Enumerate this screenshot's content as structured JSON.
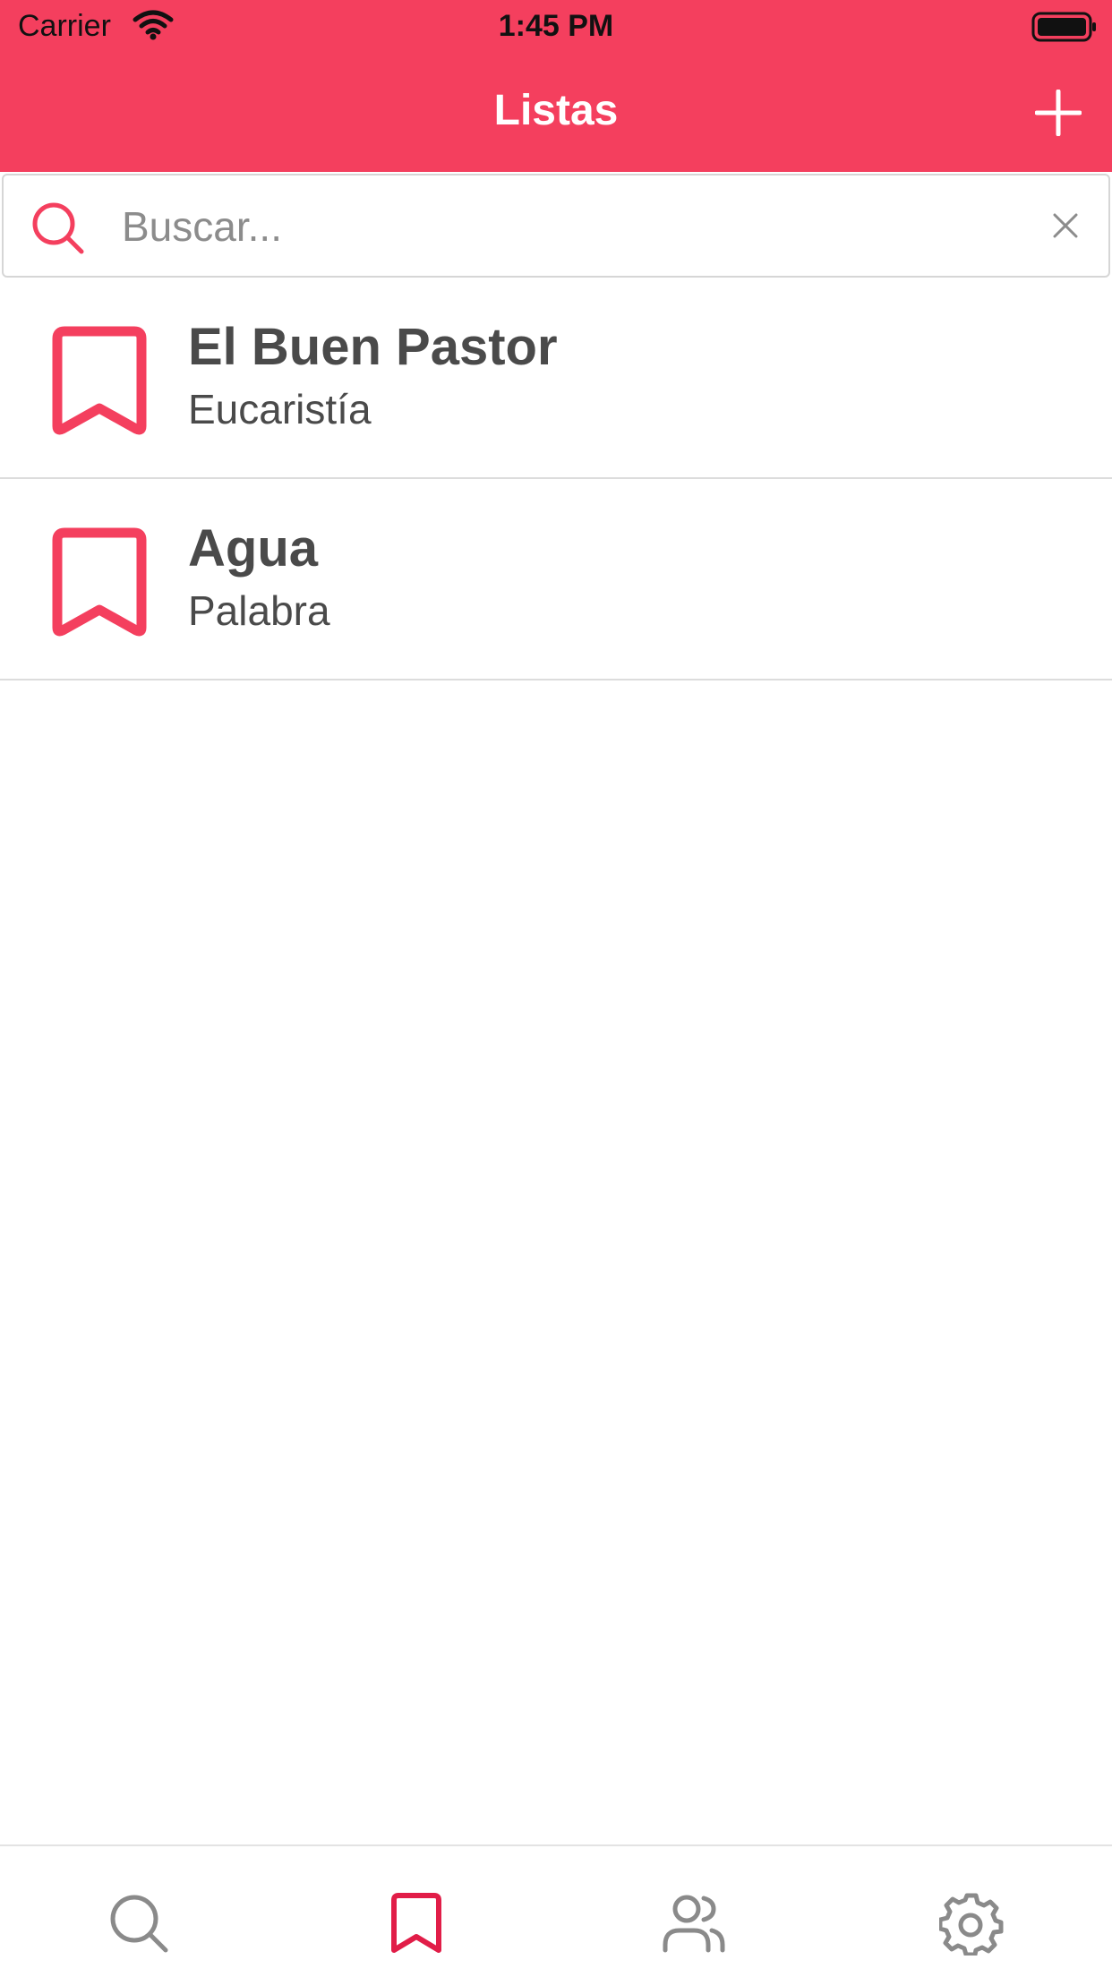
{
  "status_bar": {
    "carrier": "Carrier",
    "time": "1:45 PM",
    "icons": [
      "wifi-icon",
      "battery-icon"
    ]
  },
  "nav": {
    "title": "Listas",
    "add_icon": "plus-icon"
  },
  "search": {
    "placeholder": "Buscar...",
    "value": "",
    "icon": "search-icon",
    "clear_icon": "close-icon"
  },
  "lists": [
    {
      "title": "El Buen Pastor",
      "subtitle": "Eucaristía",
      "icon": "bookmark-icon"
    },
    {
      "title": "Agua",
      "subtitle": "Palabra",
      "icon": "bookmark-icon"
    }
  ],
  "tab_bar": {
    "tabs": [
      {
        "name": "search",
        "icon": "search-icon",
        "active": false
      },
      {
        "name": "lists",
        "icon": "bookmark-icon",
        "active": true
      },
      {
        "name": "groups",
        "icon": "users-icon",
        "active": false
      },
      {
        "name": "settings",
        "icon": "gear-icon",
        "active": false
      }
    ]
  },
  "colors": {
    "accent": "#f43f5e",
    "text": "#4a4a4a",
    "tab_inactive": "#8a8a8a",
    "divider": "#dcdcdc"
  }
}
